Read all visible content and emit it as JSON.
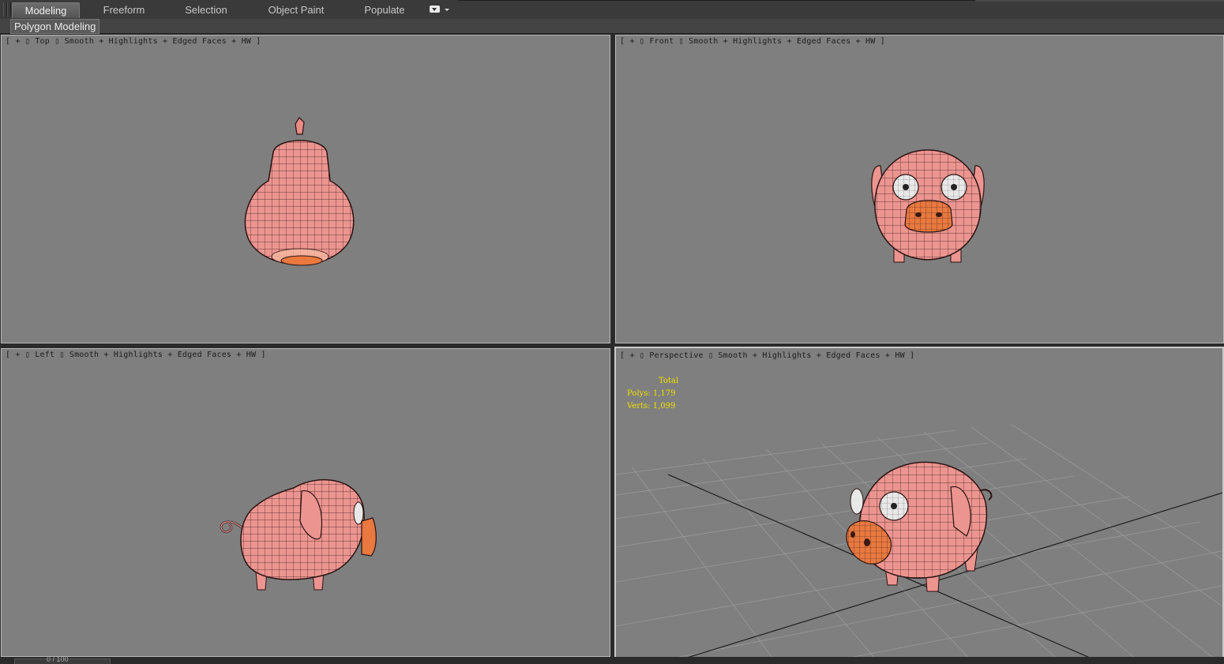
{
  "ribbon": {
    "tabs": [
      {
        "label": "Modeling",
        "active": true
      },
      {
        "label": "Freeform",
        "active": false
      },
      {
        "label": "Selection",
        "active": false
      },
      {
        "label": "Object Paint",
        "active": false
      },
      {
        "label": "Populate",
        "active": false
      }
    ],
    "panel_label": "Polygon Modeling",
    "dropdown_icon": "ribbon-options-icon"
  },
  "viewports": {
    "top": {
      "label": "[ + ▯ Top ▯ Smooth + Highlights + Edged Faces + HW ]"
    },
    "front": {
      "label": "[ + ▯ Front ▯ Smooth + Highlights + Edged Faces + HW ]"
    },
    "left": {
      "label": "[ + ▯ Left ▯ Smooth + Highlights + Edged Faces + HW ]"
    },
    "perspective": {
      "label": "[ + ▯ Perspective ▯ Smooth + Highlights + Edged Faces + HW ]",
      "stats": {
        "total": "Total",
        "polys": "Polys: 1,179",
        "verts": "Verts: 1,099"
      }
    }
  },
  "colors": {
    "viewport_bg": "#7f7f7f",
    "mesh_skin": "#e98b86",
    "mesh_snout": "#e9793f",
    "stats_text": "#f0e000"
  },
  "timeline": {
    "frame_counter": "0 / 100"
  }
}
